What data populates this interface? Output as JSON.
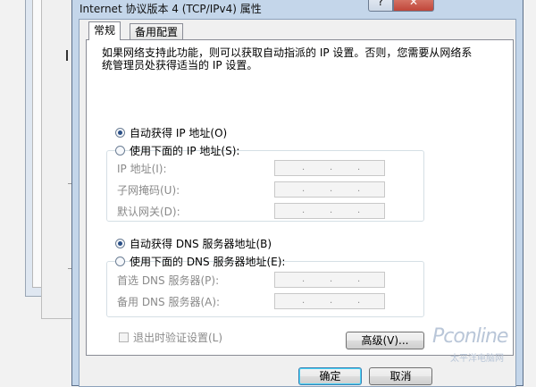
{
  "dialog": {
    "title": "Internet 协议版本 4 (TCP/IPv4) 属性",
    "help_label": "?",
    "close_label": "✕"
  },
  "tabs": [
    {
      "label": "常规"
    },
    {
      "label": "备用配置"
    }
  ],
  "description": "如果网络支持此功能，则可以获取自动指派的 IP 设置。否则，您需要从网络系统管理员处获得适当的 IP 设置。",
  "ip_section": {
    "auto_label": "自动获得 IP 地址(O)",
    "manual_label": "使用下面的 IP 地址(S):",
    "fields": [
      {
        "label": "IP 地址(I):"
      },
      {
        "label": "子网掩码(U):"
      },
      {
        "label": "默认网关(D):"
      }
    ]
  },
  "dns_section": {
    "auto_label": "自动获得 DNS 服务器地址(B)",
    "manual_label": "使用下面的 DNS 服务器地址(E):",
    "fields": [
      {
        "label": "首选 DNS 服务器(P):"
      },
      {
        "label": "备用 DNS 服务器(A):"
      }
    ]
  },
  "ip_dot": ".",
  "validate_label": "退出时验证设置(L)",
  "advanced_label": "高级(V)...",
  "ok_label": "确定",
  "cancel_label": "取消",
  "watermark": {
    "brand": "Pconline",
    "sub": "太平洋电脑网"
  },
  "colors": {
    "title_bar": "#c4d6ea",
    "close_button": "#c0463a",
    "ok_focus": "#3c7fb1"
  }
}
